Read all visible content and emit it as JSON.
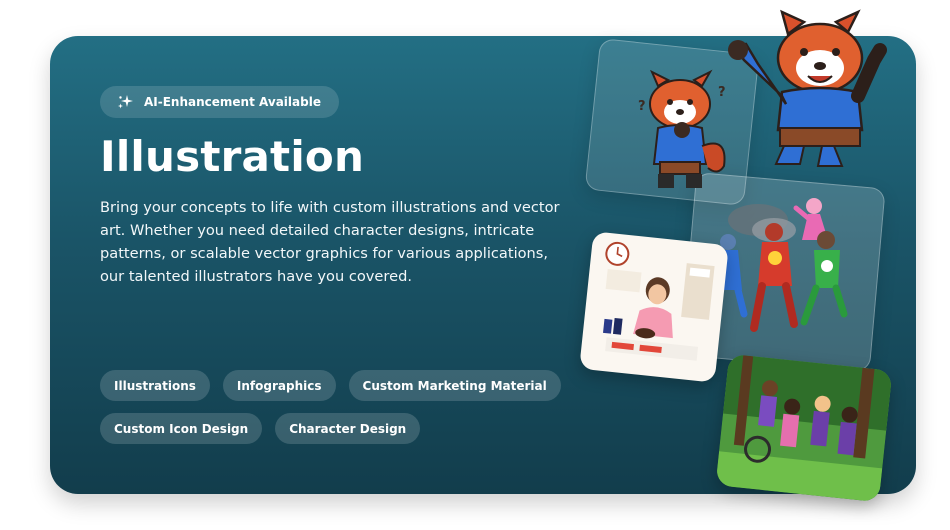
{
  "badge": {
    "icon": "sparkle-icon",
    "label": "AI-Enhancement Available"
  },
  "title": "Illustration",
  "description": "Bring your concepts to life with custom illustrations and vector art. Whether you need detailed character designs, intricate patterns, or scalable vector graphics for various applications, our talented illustrators have you covered.",
  "tags": {
    "row1": [
      "Illustrations",
      "Infographics",
      "Custom Marketing Material"
    ],
    "row2": [
      "Custom Icon Design",
      "Character Design"
    ]
  },
  "colors": {
    "card_top": "#236f84",
    "card_bottom": "#123d4c",
    "tag_bg": "rgba(255,255,255,0.16)",
    "text": "#ffffff"
  },
  "artwork": {
    "icons": [
      "red-panda-thinking-illustration",
      "red-panda-waving-illustration",
      "superhero-team-illustration",
      "coffee-woman-illustration",
      "kids-in-forest-illustration"
    ]
  }
}
